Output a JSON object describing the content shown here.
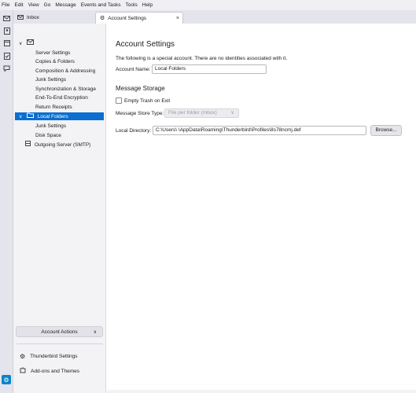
{
  "menu": [
    "File",
    "Edit",
    "View",
    "Go",
    "Message",
    "Events and Tasks",
    "Tools",
    "Help"
  ],
  "spaces": {
    "icons": [
      "mail-icon",
      "address-book-icon",
      "calendar-icon",
      "tasks-icon",
      "chat-icon"
    ],
    "settings_icon": "gear-icon"
  },
  "tabs": [
    {
      "label": "Inbox",
      "icon": "inbox-icon",
      "active": false
    },
    {
      "label": "Account Settings",
      "icon": "gear-icon",
      "active": true,
      "close": "×"
    }
  ],
  "sidebar": {
    "root_icon": "account-icon",
    "items": [
      {
        "label": "Server Settings"
      },
      {
        "label": "Copies & Folders"
      },
      {
        "label": "Composition & Addressing"
      },
      {
        "label": "Junk Settings"
      },
      {
        "label": "Synchronization & Storage"
      },
      {
        "label": "End-To-End Encryption"
      },
      {
        "label": "Return Receipts"
      },
      {
        "label": "Local Folders",
        "selected": true
      },
      {
        "label": "Junk Settings"
      },
      {
        "label": "Disk Space"
      },
      {
        "label": "Outgoing Server (SMTP)"
      }
    ],
    "account_actions": "Account Actions",
    "footer": [
      {
        "label": "Thunderbird Settings",
        "icon": "gear-icon"
      },
      {
        "label": "Add-ons and Themes",
        "icon": "puzzle-icon"
      }
    ]
  },
  "main": {
    "title": "Account Settings",
    "note": "The following is a special account. There are no identities associated with it.",
    "account_name_label": "Account Name:",
    "account_name_value": "Local Folders",
    "storage_heading": "Message Storage",
    "empty_trash_label": "Empty Trash on Exit",
    "empty_trash_checked": false,
    "store_type_label": "Message Store Type:",
    "store_type_value": "File per folder (mbox)",
    "local_dir_label": "Local Directory:",
    "local_dir_value": "C:\\Users\\                              \\AppData\\Roaming\\Thunderbird\\Profiles\\8s78ncmj.def",
    "browse_label": "Browse..."
  },
  "colors": {
    "accent": "#0a6fd1",
    "sidebar_bg": "#f3f3f6",
    "tabbar_bg": "#e4e4ec"
  }
}
